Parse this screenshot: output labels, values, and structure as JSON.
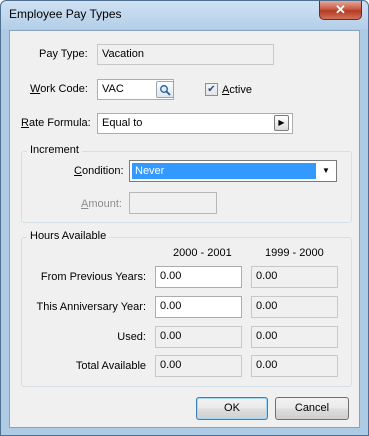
{
  "window": {
    "title": "Employee Pay Types",
    "close_label": "✕"
  },
  "form": {
    "pay_type_label": "Pay Type:",
    "pay_type_value": "Vacation",
    "work_code_label_acc": "W",
    "work_code_label_rest": "ork Code:",
    "work_code_value": "VAC",
    "active_label_acc": "A",
    "active_label_rest": "ctive",
    "active_checked": true,
    "rate_formula_label_acc": "R",
    "rate_formula_label_rest": "ate Formula:",
    "rate_formula_value": "Equal to"
  },
  "increment": {
    "title": "Increment",
    "condition_label_acc": "C",
    "condition_label_rest": "ondition:",
    "condition_value": "Never",
    "amount_label_acc": "A",
    "amount_label_rest": "mount:",
    "amount_value": ""
  },
  "hours": {
    "title": "Hours Available",
    "col_current": "2000 - 2001",
    "col_prior": "1999 - 2000",
    "rows": [
      {
        "label": "From Previous Years:",
        "current": "0.00",
        "prior": "0.00"
      },
      {
        "label": "This Anniversary Year:",
        "current": "0.00",
        "prior": "0.00"
      },
      {
        "label": "Used:",
        "current": "0.00",
        "prior": "0.00"
      },
      {
        "label": "Total Available",
        "current": "0.00",
        "prior": "0.00"
      }
    ]
  },
  "buttons": {
    "ok": "OK",
    "cancel": "Cancel"
  },
  "icons": {
    "lookup": "magnifier-icon",
    "expand": "arrow-right-icon",
    "dropdown": "chevron-down-icon",
    "check": "checkmark-icon"
  }
}
